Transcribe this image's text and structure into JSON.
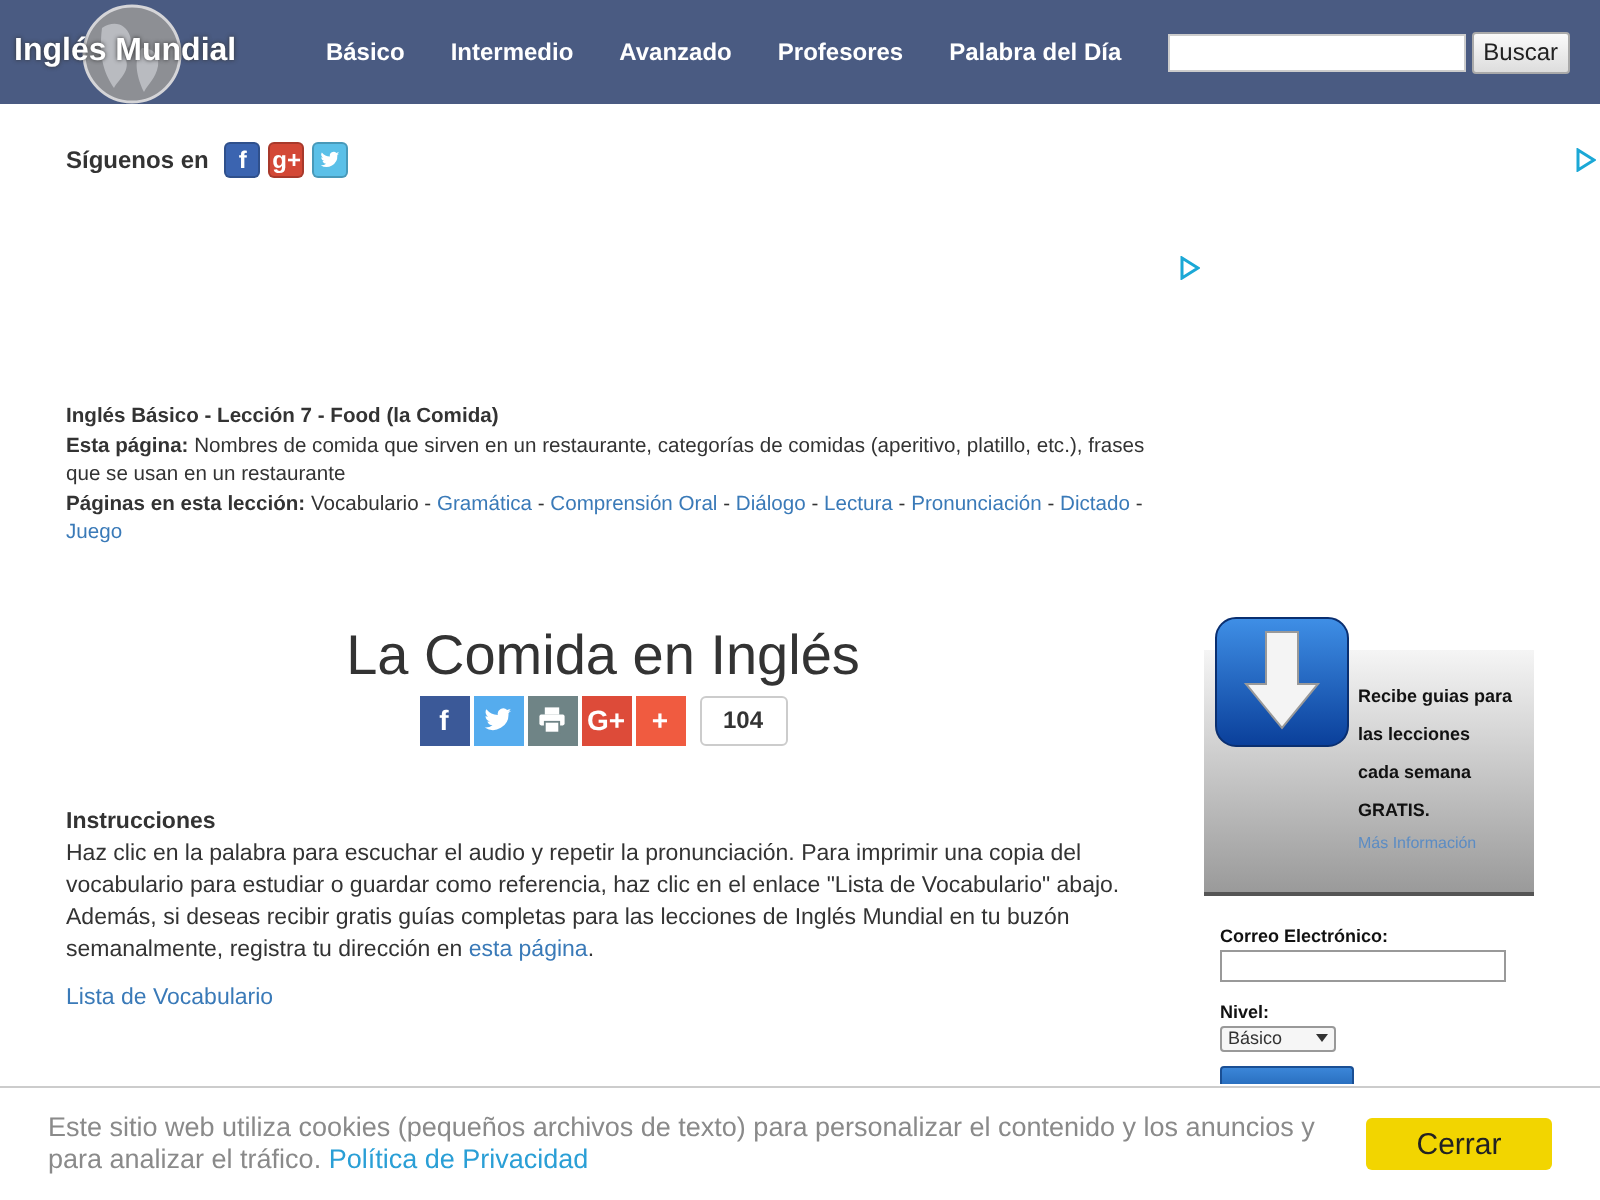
{
  "header": {
    "logo": "Inglés Mundial",
    "nav": [
      "Básico",
      "Intermedio",
      "Avanzado",
      "Profesores",
      "Palabra del Día"
    ],
    "search": {
      "button": "Buscar"
    }
  },
  "follow": {
    "label": "Síguenos en",
    "networks": [
      {
        "kind": "facebook",
        "glyph": "f"
      },
      {
        "kind": "googleplus",
        "glyph": "g+"
      },
      {
        "kind": "twitter"
      }
    ]
  },
  "lesson": {
    "title": "Inglés Básico - Lección 7 - Food (la Comida)",
    "page_label": "Esta página:",
    "page_text": "Nombres de comida que sirven en un restaurante, categorías de comidas (aperitivo, platillo, etc.), frases que se usan en un restaurante",
    "pages_label": "Páginas en esta lección:",
    "separator": "-",
    "pages": [
      {
        "label": "Vocabulario",
        "selected": true
      },
      {
        "label": "Gramática",
        "selected": false
      },
      {
        "label": "Comprensión Oral",
        "selected": false
      },
      {
        "label": "Diálogo",
        "selected": false
      },
      {
        "label": "Lectura",
        "selected": false
      },
      {
        "label": "Pronunciación",
        "selected": false
      },
      {
        "label": "Dictado",
        "selected": false
      },
      {
        "label": "Juego",
        "selected": false
      }
    ]
  },
  "heading": "La Comida en Inglés",
  "share": {
    "buttons": [
      {
        "kind": "facebook",
        "glyph": "f"
      },
      {
        "kind": "twitter"
      },
      {
        "kind": "print"
      },
      {
        "kind": "googleplus",
        "glyph": "G+"
      },
      {
        "kind": "more",
        "glyph": "+"
      }
    ],
    "count": "104"
  },
  "instructions": {
    "title": "Instrucciones",
    "text_before": "Haz clic en la palabra para escuchar el audio y repetir la pronunciación. Para imprimir una copia del vocabulario para estudiar o guardar como referencia, haz clic en el enlace \"Lista de Vocabulario\" abajo. Además, si deseas recibir gratis guías completas para las lecciones de Inglés Mundial en tu buzón semanalmente, registra tu dirección en ",
    "link": "esta página",
    "text_after": ".",
    "vocab_link": "Lista de Vocabulario"
  },
  "signup": {
    "text": "Recibe guias para las lecciones cada semana GRATIS.",
    "more_link": "Más Información",
    "email_label": "Correo Electrónico:",
    "level_label": "Nivel:",
    "level_value": "Básico"
  },
  "cookie": {
    "text": "Este sitio web utiliza cookies (pequeños archivos de texto) para personalizar el contenido y los anuncios y para analizar el tráfico. ",
    "link": "Política de Privacidad",
    "button": "Cerrar"
  }
}
